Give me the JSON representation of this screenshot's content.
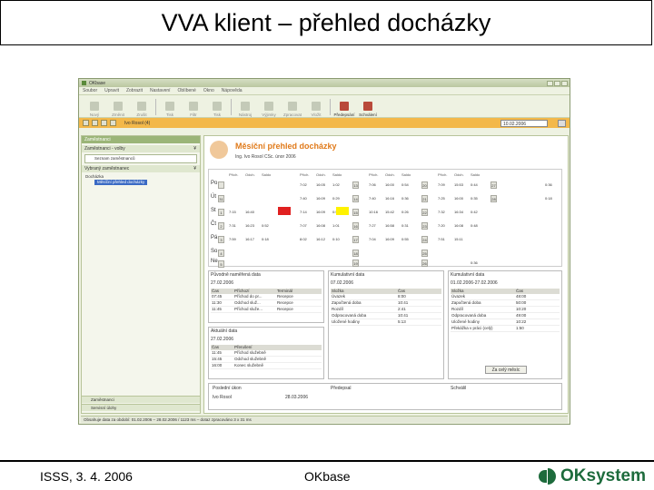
{
  "slide": {
    "title": "VVA klient – přehled docházky",
    "footer_left": "ISSS, 3. 4. 2006",
    "footer_middle": "OKbase",
    "logo_text": "OKsystem",
    "logo_color": "#1d6b3c"
  },
  "app": {
    "window_title": "OKbase",
    "menu": [
      "Soubor",
      "Upravit",
      "Zobrazit",
      "Nastavení",
      "Oblíbené",
      "Okno",
      "Nápověda"
    ],
    "toolbar": [
      "Nový",
      "Změnit",
      "Zrušit",
      "Tisk",
      "Filtr",
      "Tisk",
      "Nástroj",
      "Výjimky",
      "Zpracovat",
      "Vložit",
      "Předepsání",
      "Schválení"
    ],
    "employee": "Ivo Rosol (4)",
    "date_field": "10.02.2006",
    "accent_color": "#f3b84a",
    "left_panel": {
      "header": "Zaměstnanci",
      "section1": "Zaměstnanci - volby",
      "link1": "Seznam zaměstnanců",
      "section2": "Vybraný zaměstnanec",
      "tree_root": "Docházka",
      "tree_selected": "Měsíční přehled docházky",
      "bottom1": "Zaměstnanci",
      "bottom2": "Servisní úlohy"
    },
    "main": {
      "title": "Měsíční přehled docházky",
      "subtitle": "Ing. Ivo Rosol CSc.   únor 2006",
      "col_headers": [
        "Přích.",
        "Odch.",
        "Saldo",
        "Přích.",
        "Odch.",
        "Saldo",
        "Přích.",
        "Odch.",
        "Saldo",
        "Přích.",
        "Odch.",
        "Saldo"
      ],
      "days": [
        "Po",
        "Út",
        "St",
        "Čt",
        "Pá",
        "So",
        "Ne"
      ],
      "week_nums": [
        "",
        "31",
        "1",
        "2",
        "3",
        "4",
        "5"
      ],
      "rows": [
        [
          "",
          "",
          "",
          "",
          "",
          "",
          "7:02",
          "16:05",
          "1:02",
          "13",
          "7:06",
          "16:00",
          "0:54",
          "20",
          "7:09",
          "15:53",
          "0:44",
          "27",
          "",
          "",
          "0:36"
        ],
        [
          "",
          "",
          "",
          "",
          "",
          "",
          "7:40",
          "16:09",
          "0:29",
          "14",
          "7:40",
          "16:16",
          "0:36",
          "21",
          "7:25",
          "16:00",
          "0:35",
          "28",
          "",
          "",
          "0:18"
        ],
        [
          "7:15",
          "16:40",
          "",
          "",
          "",
          "",
          "7:14",
          "16:09",
          "0:55",
          "15",
          "10:16",
          "15:42",
          "0:26",
          "22",
          "7:32",
          "16:34",
          "0:42",
          "",
          "",
          "",
          ""
        ],
        [
          "7:31",
          "16:23",
          "0:52",
          "",
          "",
          "",
          "7:07",
          "16:08",
          "1:01",
          "16",
          "7:27",
          "16:58",
          "0:31",
          "23",
          "7:20",
          "16:08",
          "0:48",
          "",
          "",
          "",
          ""
        ],
        [
          "7:59",
          "16:17",
          "0:18",
          "",
          "",
          "",
          "8:02",
          "16:12",
          "0:10",
          "17",
          "7:04",
          "16:09",
          "0:55",
          "24",
          "7:51",
          "15:11",
          "",
          "",
          "",
          "",
          ""
        ],
        [
          "",
          "",
          "",
          "",
          "",
          "",
          "",
          "",
          "",
          "18",
          "",
          "",
          "",
          "25",
          "",
          "",
          "",
          "",
          "",
          "",
          ""
        ],
        [
          "",
          "",
          "",
          "",
          "",
          "",
          "",
          "",
          "",
          "19",
          "",
          "",
          "",
          "26",
          "",
          "",
          "0:36",
          "",
          "",
          "",
          ""
        ]
      ],
      "orig_header": "Původně naměřená data",
      "orig_date": "27.02.2006",
      "orig_cols": [
        "Čas",
        "Příchozí",
        "Terminál"
      ],
      "orig_rows": [
        [
          "07:45",
          "Příchod do pr...",
          "Recepce"
        ],
        [
          "11:30",
          "Odchod služ...",
          "Recepce"
        ],
        [
          "11:45",
          "Příchod služe...",
          "Recepce"
        ]
      ],
      "actual_header": "Aktuální data",
      "actual_date": "27.02.2006",
      "actual_cols": [
        "Čas",
        "Přerušení"
      ],
      "actual_rows": [
        [
          "11:45",
          "Příchod služebně"
        ],
        [
          "15:45",
          "Odchod služebně"
        ],
        [
          "16:00",
          "Konec služebně"
        ]
      ],
      "cum_header": "Kumulativní data",
      "cum_date": "07.02.2006",
      "cum_cols": [
        "Složka",
        "Čas"
      ],
      "cum_rows": [
        [
          "Úvazek",
          "8:00"
        ],
        [
          "Započtená doba",
          "10:41"
        ],
        [
          "Rozdíl",
          "2:41"
        ],
        [
          "Odpracovaná doba",
          "10:41"
        ],
        [
          "Uložené hodiny",
          "5:13"
        ]
      ],
      "month_header": "Kumulativní data",
      "month_range": "01.02.2006-27.02.2006",
      "month_cols": [
        "Složka",
        "Čas"
      ],
      "month_rows": [
        [
          "Úvazek",
          "48:00"
        ],
        [
          "Započtená doba",
          "50:00"
        ],
        [
          "Rozdíl",
          "10:20"
        ],
        [
          "Odpracovaná doba",
          "49:00"
        ],
        [
          "Uložené hodiny",
          "10:22"
        ],
        [
          "Překážka v práci (celý)",
          "1:50"
        ]
      ],
      "month_button": "Za celý měsíc",
      "bottom_labels": [
        "Poslední úkon",
        "Předepsal",
        "Schválil"
      ],
      "last_user": "Ivo Rosol",
      "last_date": "28.03.2006"
    },
    "status": "Obsahuje data za období: 01.02.2006 – 28.02.2006 / 1123 ms – dotaz zpracováno 3 x 31 ms"
  }
}
